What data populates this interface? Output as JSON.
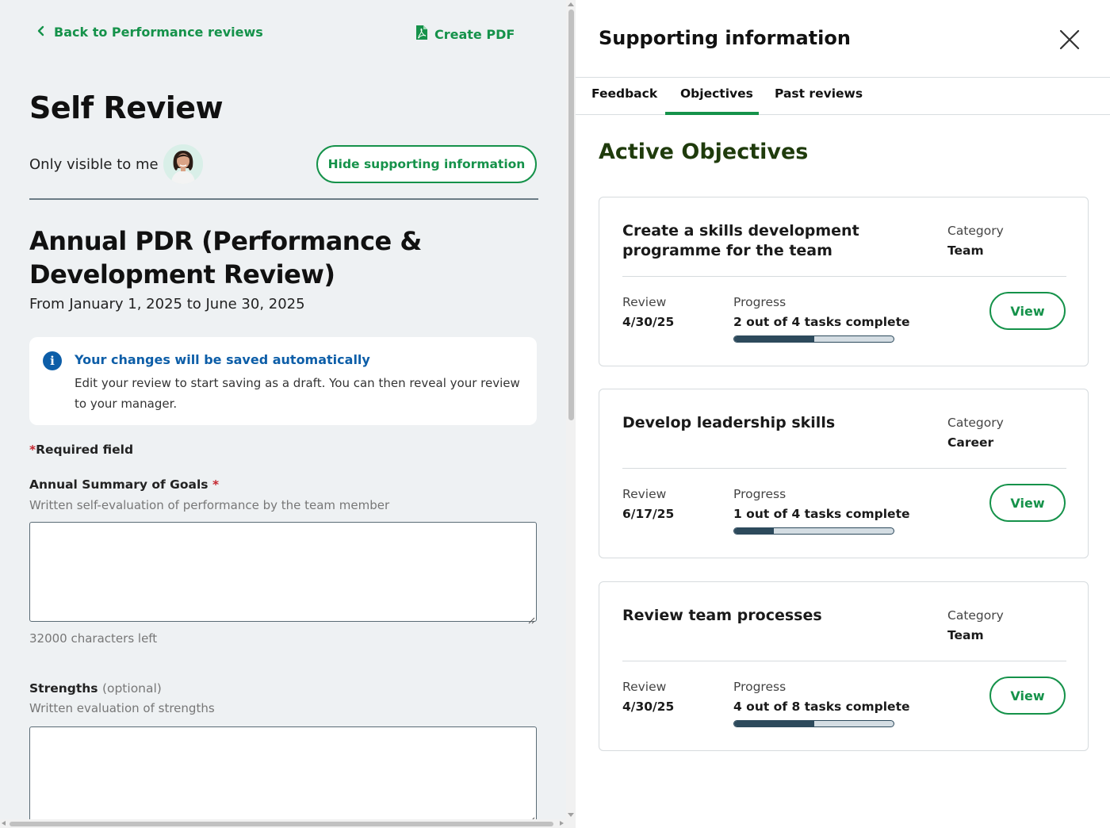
{
  "left": {
    "back_label": "Back to Performance reviews",
    "pdf_label": "Create PDF",
    "page_title": "Self Review",
    "visibility": "Only visible to me",
    "hide_button": "Hide supporting information",
    "review_title": "Annual PDR (Performance & Development Review)",
    "review_dates": "From January 1, 2025 to June 30, 2025",
    "notice": {
      "title": "Your changes will be saved automatically",
      "body": "Edit your review to start saving as a draft. You can then reveal your review to your manager."
    },
    "required_star": "*",
    "required_text": "Required field",
    "fields": [
      {
        "label": "Annual Summary of Goals",
        "marker": "*",
        "description": "Written self-evaluation of performance by the team member",
        "value": "",
        "chars_left": "32000 characters left"
      },
      {
        "label": "Strengths",
        "marker": "(optional)",
        "description": "Written evaluation of strengths",
        "value": ""
      }
    ]
  },
  "panel": {
    "title": "Supporting information",
    "tabs": [
      "Feedback",
      "Objectives",
      "Past reviews"
    ],
    "active_tab": "Objectives",
    "section_title": "Active Objectives",
    "objectives": [
      {
        "title": "Create a skills development programme for the team",
        "category_label": "Category",
        "category": "Team",
        "review_label": "Review",
        "review_date": "4/30/25",
        "progress_label": "Progress",
        "progress_text": "2 out of 4 tasks complete",
        "progress_fraction": 0.5,
        "view_label": "View"
      },
      {
        "title": "Develop leadership skills",
        "category_label": "Category",
        "category": "Career",
        "review_label": "Review",
        "review_date": "6/17/25",
        "progress_label": "Progress",
        "progress_text": "1 out of 4 tasks complete",
        "progress_fraction": 0.25,
        "view_label": "View"
      },
      {
        "title": "Review team processes",
        "category_label": "Category",
        "category": "Team",
        "review_label": "Review",
        "review_date": "4/30/25",
        "progress_label": "Progress",
        "progress_text": "4 out of 8 tasks complete",
        "progress_fraction": 0.5,
        "view_label": "View"
      }
    ]
  },
  "icons": {
    "back": "chevron-left-icon",
    "pdf": "pdf-file-icon",
    "info": "info-icon",
    "close": "close-icon"
  },
  "colors": {
    "accent_green": "#15924a",
    "info_blue": "#0d5ea8",
    "required_red": "#c4262e",
    "progress_fill": "#2d4a5c",
    "section_title": "#1f3b0c",
    "left_background": "#eef1f3"
  }
}
